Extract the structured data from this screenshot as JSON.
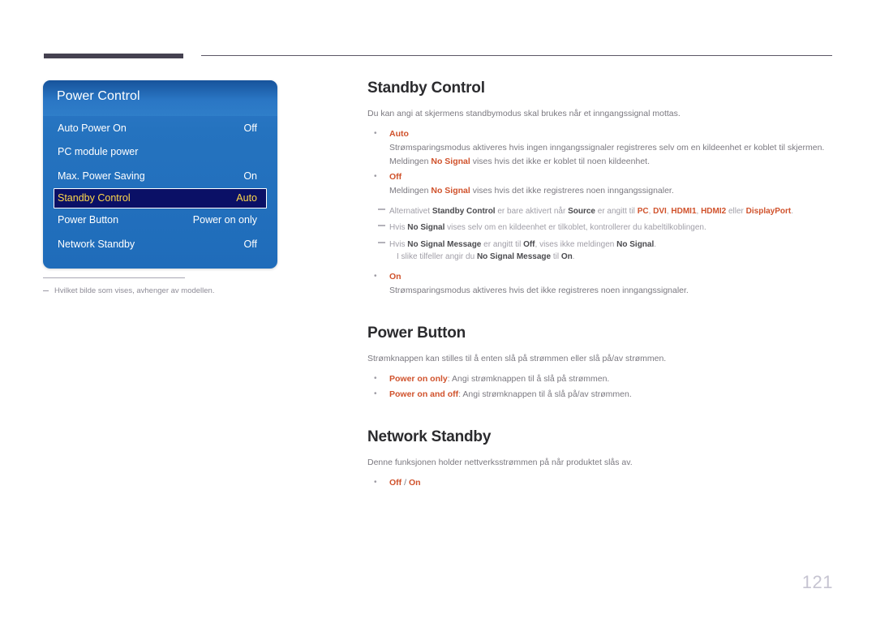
{
  "page": {
    "number": "121"
  },
  "osd": {
    "title": "Power Control",
    "rows": [
      {
        "label": "Auto Power On",
        "value": "Off",
        "selected": false
      },
      {
        "label": "PC module power",
        "value": "",
        "selected": false
      },
      {
        "label": "Max. Power Saving",
        "value": "On",
        "selected": false
      },
      {
        "label": "Standby Control",
        "value": "Auto",
        "selected": true
      },
      {
        "label": "Power Button",
        "value": "Power on only",
        "selected": false
      },
      {
        "label": "Network Standby",
        "value": "Off",
        "selected": false
      }
    ],
    "footnote": "Hvilket bilde som vises, avhenger av modellen."
  },
  "sections": [
    {
      "title": "Standby Control",
      "intro": "Du kan angi at skjermens standbymodus skal brukes når et inngangssignal mottas.",
      "bullets": [
        {
          "head": "Auto",
          "body": "",
          "lines": [
            "Strømsparingsmodus aktiveres hvis ingen inngangssignaler registreres selv om en kildeenhet er koblet til skjermen.",
            "Meldingen No Signal vises hvis det ikke er koblet til noen kildeenhet."
          ]
        },
        {
          "head": "Off",
          "body": "",
          "lines": [
            "Meldingen No Signal vises hvis det ikke registreres noen inngangssignaler."
          ]
        }
      ],
      "notes": [
        "Alternativet Standby Control er bare aktivert når Source er angitt til PC, DVI, HDMI1, HDMI2 eller DisplayPort.",
        "Hvis No Signal vises selv om en kildeenhet er tilkoblet, kontrollerer du kabeltilkoblingen.",
        "Hvis No Signal Message er angitt til Off, vises ikke meldingen No Signal.",
        "I slike tilfeller angir du No Signal Message til On."
      ],
      "bullets_after": [
        {
          "head": "On",
          "body": "",
          "lines": [
            "Strømsparingsmodus aktiveres hvis det ikke registreres noen inngangssignaler."
          ]
        }
      ]
    },
    {
      "title": "Power Button",
      "intro": "Strømknappen kan stilles til å enten slå på strømmen eller slå på/av strømmen.",
      "bullets": [
        {
          "head": "Power on only",
          "body": ": Angi strømknappen til å slå på strømmen."
        },
        {
          "head": "Power on and off",
          "body": ": Angi strømknappen til å slå på/av strømmen."
        }
      ]
    },
    {
      "title": "Network Standby",
      "intro": "Denne funksjonen holder nettverksstrømmen på når produktet slås av.",
      "bullets": [
        {
          "head": "Off",
          "body": " / ",
          "head2": "On"
        }
      ]
    }
  ],
  "text_fragments": {
    "sb_auto_l1": "Strømsparingsmodus aktiveres hvis ingen inngangssignaler registreres selv om en kildeenhet er koblet til skjermen.",
    "sb_auto_l2_a": "Meldingen ",
    "sb_auto_l2_b": "No Signal",
    "sb_auto_l2_c": " vises hvis det ikke er koblet til noen kildeenhet.",
    "sb_off_l1_a": "Meldingen ",
    "sb_off_l1_b": "No Signal",
    "sb_off_l1_c": " vises hvis det ikke registreres noen inngangssignaler.",
    "note1_a": "Alternativet ",
    "note1_b": "Standby Control",
    "note1_c": " er bare aktivert når ",
    "note1_d": "Source",
    "note1_e": " er angitt til ",
    "note1_f": "PC",
    "note1_g": ", ",
    "note1_h": "DVI",
    "note1_i": ", ",
    "note1_j": "HDMI1",
    "note1_k": ", ",
    "note1_l": "HDMI2",
    "note1_m": " eller ",
    "note1_n": "DisplayPort",
    "note1_o": ".",
    "note2_a": "Hvis ",
    "note2_b": "No Signal",
    "note2_c": " vises selv om en kildeenhet er tilkoblet, kontrollerer du kabeltilkoblingen.",
    "note3_a": "Hvis ",
    "note3_b": "No Signal Message",
    "note3_c": " er angitt til ",
    "note3_d": "Off",
    "note3_e": ", vises ikke meldingen ",
    "note3_f": "No Signal",
    "note3_g": ".",
    "note3_cont_a": "I slike tilfeller angir du ",
    "note3_cont_b": "No Signal Message",
    "note3_cont_c": " til ",
    "note3_cont_d": "On",
    "note3_cont_e": ".",
    "sb_on_l1": "Strømsparingsmodus aktiveres hvis det ikke registreres noen inngangssignaler."
  },
  "colors": {
    "accent_orange": "#d0522c",
    "osd_blue": "#2573bf",
    "osd_selected_bg": "#0a1066",
    "osd_selected_text": "#ffd84a",
    "heading": "#2b2b2e",
    "body": "#7b7980",
    "page_number": "#c6c4d1"
  }
}
